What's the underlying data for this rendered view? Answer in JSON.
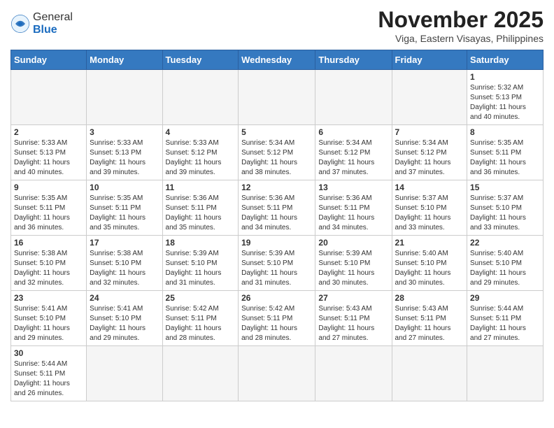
{
  "header": {
    "logo_general": "General",
    "logo_blue": "Blue",
    "month_title": "November 2025",
    "location": "Viga, Eastern Visayas, Philippines"
  },
  "days_of_week": [
    "Sunday",
    "Monday",
    "Tuesday",
    "Wednesday",
    "Thursday",
    "Friday",
    "Saturday"
  ],
  "weeks": [
    [
      {
        "day": "",
        "empty": true
      },
      {
        "day": "",
        "empty": true
      },
      {
        "day": "",
        "empty": true
      },
      {
        "day": "",
        "empty": true
      },
      {
        "day": "",
        "empty": true
      },
      {
        "day": "",
        "empty": true
      },
      {
        "day": "1",
        "sunrise": "5:32 AM",
        "sunset": "5:13 PM",
        "daylight_hours": "11 hours",
        "daylight_minutes": "and 40 minutes."
      }
    ],
    [
      {
        "day": "2",
        "sunrise": "5:33 AM",
        "sunset": "5:13 PM",
        "daylight_hours": "11 hours",
        "daylight_minutes": "and 40 minutes."
      },
      {
        "day": "3",
        "sunrise": "5:33 AM",
        "sunset": "5:13 PM",
        "daylight_hours": "11 hours",
        "daylight_minutes": "and 39 minutes."
      },
      {
        "day": "4",
        "sunrise": "5:33 AM",
        "sunset": "5:12 PM",
        "daylight_hours": "11 hours",
        "daylight_minutes": "and 39 minutes."
      },
      {
        "day": "5",
        "sunrise": "5:34 AM",
        "sunset": "5:12 PM",
        "daylight_hours": "11 hours",
        "daylight_minutes": "and 38 minutes."
      },
      {
        "day": "6",
        "sunrise": "5:34 AM",
        "sunset": "5:12 PM",
        "daylight_hours": "11 hours",
        "daylight_minutes": "and 37 minutes."
      },
      {
        "day": "7",
        "sunrise": "5:34 AM",
        "sunset": "5:12 PM",
        "daylight_hours": "11 hours",
        "daylight_minutes": "and 37 minutes."
      },
      {
        "day": "8",
        "sunrise": "5:35 AM",
        "sunset": "5:11 PM",
        "daylight_hours": "11 hours",
        "daylight_minutes": "and 36 minutes."
      }
    ],
    [
      {
        "day": "9",
        "sunrise": "5:35 AM",
        "sunset": "5:11 PM",
        "daylight_hours": "11 hours",
        "daylight_minutes": "and 36 minutes."
      },
      {
        "day": "10",
        "sunrise": "5:35 AM",
        "sunset": "5:11 PM",
        "daylight_hours": "11 hours",
        "daylight_minutes": "and 35 minutes."
      },
      {
        "day": "11",
        "sunrise": "5:36 AM",
        "sunset": "5:11 PM",
        "daylight_hours": "11 hours",
        "daylight_minutes": "and 35 minutes."
      },
      {
        "day": "12",
        "sunrise": "5:36 AM",
        "sunset": "5:11 PM",
        "daylight_hours": "11 hours",
        "daylight_minutes": "and 34 minutes."
      },
      {
        "day": "13",
        "sunrise": "5:36 AM",
        "sunset": "5:11 PM",
        "daylight_hours": "11 hours",
        "daylight_minutes": "and 34 minutes."
      },
      {
        "day": "14",
        "sunrise": "5:37 AM",
        "sunset": "5:10 PM",
        "daylight_hours": "11 hours",
        "daylight_minutes": "and 33 minutes."
      },
      {
        "day": "15",
        "sunrise": "5:37 AM",
        "sunset": "5:10 PM",
        "daylight_hours": "11 hours",
        "daylight_minutes": "and 33 minutes."
      }
    ],
    [
      {
        "day": "16",
        "sunrise": "5:38 AM",
        "sunset": "5:10 PM",
        "daylight_hours": "11 hours",
        "daylight_minutes": "and 32 minutes."
      },
      {
        "day": "17",
        "sunrise": "5:38 AM",
        "sunset": "5:10 PM",
        "daylight_hours": "11 hours",
        "daylight_minutes": "and 32 minutes."
      },
      {
        "day": "18",
        "sunrise": "5:39 AM",
        "sunset": "5:10 PM",
        "daylight_hours": "11 hours",
        "daylight_minutes": "and 31 minutes."
      },
      {
        "day": "19",
        "sunrise": "5:39 AM",
        "sunset": "5:10 PM",
        "daylight_hours": "11 hours",
        "daylight_minutes": "and 31 minutes."
      },
      {
        "day": "20",
        "sunrise": "5:39 AM",
        "sunset": "5:10 PM",
        "daylight_hours": "11 hours",
        "daylight_minutes": "and 30 minutes."
      },
      {
        "day": "21",
        "sunrise": "5:40 AM",
        "sunset": "5:10 PM",
        "daylight_hours": "11 hours",
        "daylight_minutes": "and 30 minutes."
      },
      {
        "day": "22",
        "sunrise": "5:40 AM",
        "sunset": "5:10 PM",
        "daylight_hours": "11 hours",
        "daylight_minutes": "and 29 minutes."
      }
    ],
    [
      {
        "day": "23",
        "sunrise": "5:41 AM",
        "sunset": "5:10 PM",
        "daylight_hours": "11 hours",
        "daylight_minutes": "and 29 minutes."
      },
      {
        "day": "24",
        "sunrise": "5:41 AM",
        "sunset": "5:10 PM",
        "daylight_hours": "11 hours",
        "daylight_minutes": "and 29 minutes."
      },
      {
        "day": "25",
        "sunrise": "5:42 AM",
        "sunset": "5:11 PM",
        "daylight_hours": "11 hours",
        "daylight_minutes": "and 28 minutes."
      },
      {
        "day": "26",
        "sunrise": "5:42 AM",
        "sunset": "5:11 PM",
        "daylight_hours": "11 hours",
        "daylight_minutes": "and 28 minutes."
      },
      {
        "day": "27",
        "sunrise": "5:43 AM",
        "sunset": "5:11 PM",
        "daylight_hours": "11 hours",
        "daylight_minutes": "and 27 minutes."
      },
      {
        "day": "28",
        "sunrise": "5:43 AM",
        "sunset": "5:11 PM",
        "daylight_hours": "11 hours",
        "daylight_minutes": "and 27 minutes."
      },
      {
        "day": "29",
        "sunrise": "5:44 AM",
        "sunset": "5:11 PM",
        "daylight_hours": "11 hours",
        "daylight_minutes": "and 27 minutes."
      }
    ],
    [
      {
        "day": "30",
        "sunrise": "5:44 AM",
        "sunset": "5:11 PM",
        "daylight_hours": "11 hours",
        "daylight_minutes": "and 26 minutes."
      },
      {
        "day": "",
        "empty": true
      },
      {
        "day": "",
        "empty": true
      },
      {
        "day": "",
        "empty": true
      },
      {
        "day": "",
        "empty": true
      },
      {
        "day": "",
        "empty": true
      },
      {
        "day": "",
        "empty": true
      }
    ]
  ],
  "labels": {
    "sunrise": "Sunrise:",
    "sunset": "Sunset:",
    "daylight": "Daylight:"
  }
}
